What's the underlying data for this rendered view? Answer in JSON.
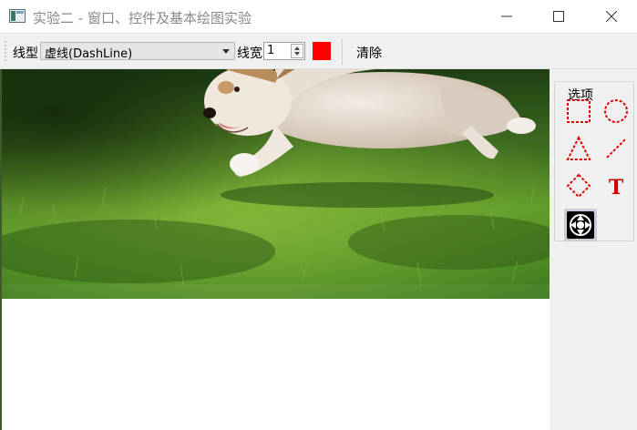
{
  "window": {
    "title": "实验二 - 窗口、控件及基本绘图实验",
    "minimize_icon": "minimize-icon",
    "maximize_icon": "maximize-icon",
    "close_icon": "close-icon"
  },
  "toolbar": {
    "line_style_label": "线型",
    "line_style_value": "虚线(DashLine)",
    "line_width_label": "线宽",
    "line_width_value": "1",
    "pen_color": "#ff0000",
    "clear_label": "清除"
  },
  "dock": {
    "group_title": "选项",
    "tools": [
      {
        "name": "rectangle",
        "icon": "rectangle-icon"
      },
      {
        "name": "ellipse",
        "icon": "ellipse-icon"
      },
      {
        "name": "triangle",
        "icon": "triangle-icon"
      },
      {
        "name": "line",
        "icon": "line-icon"
      },
      {
        "name": "diamond",
        "icon": "diamond-icon"
      },
      {
        "name": "text",
        "icon": "text-icon",
        "glyph": "T"
      },
      {
        "name": "image",
        "icon": "image-tool-icon",
        "active": true
      }
    ]
  },
  "colors": {
    "accent": "#ff0000",
    "shape_stroke": "#e00000"
  }
}
